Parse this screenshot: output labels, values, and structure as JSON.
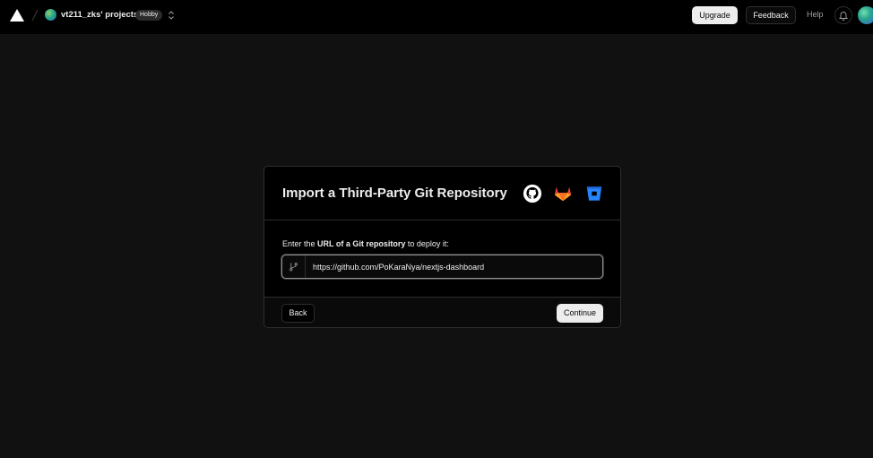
{
  "topbar": {
    "team_name": "vt211_zks' projects",
    "plan_badge": "Hobby",
    "upgrade_label": "Upgrade",
    "feedback_label": "Feedback",
    "help_label": "Help"
  },
  "import": {
    "title": "Import a Third-Party Git Repository",
    "providers": [
      "github-icon",
      "gitlab-icon",
      "bitbucket-icon"
    ],
    "prompt_prefix": "Enter the ",
    "prompt_bold": "URL of a Git repository",
    "prompt_suffix": " to deploy it:",
    "url_value": "https://github.com/PoKaraNya/nextjs-dashboard",
    "back_label": "Back",
    "continue_label": "Continue"
  },
  "colors": {
    "background": "#111111",
    "topbar": "#000000",
    "gitlab_orange": "#e2432a",
    "bitbucket_blue": "#2684ff"
  }
}
